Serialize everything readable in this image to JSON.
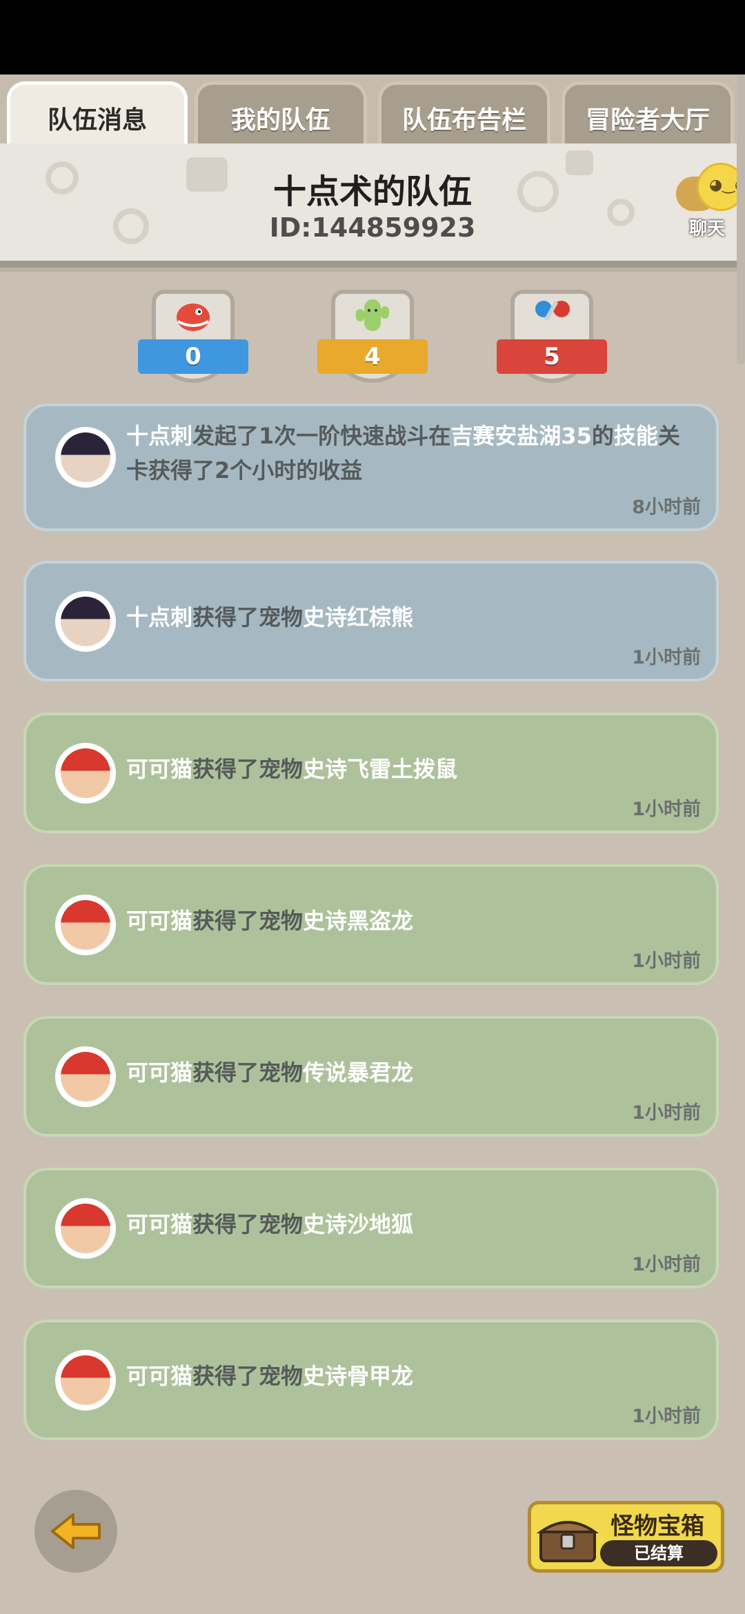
{
  "tabs": [
    {
      "label": "队伍消息",
      "active": true
    },
    {
      "label": "我的队伍",
      "active": false
    },
    {
      "label": "队伍布告栏",
      "active": false
    },
    {
      "label": "冒险者大厅",
      "active": false
    }
  ],
  "header": {
    "team_name": "十点术的队伍",
    "team_id": "ID:144859923",
    "chat_label": "聊天"
  },
  "badges": [
    {
      "value": "0",
      "color": "#3f97df",
      "icon": "red-dino-icon"
    },
    {
      "value": "4",
      "color": "#e8a92d",
      "icon": "green-cactus-icon"
    },
    {
      "value": "5",
      "color": "#d9453a",
      "icon": "adventurers-icon"
    }
  ],
  "messages": [
    {
      "style": "blue",
      "avatar": "dark-hair-hero-avatar",
      "parts": [
        {
          "t": "十点刺",
          "dark": false
        },
        {
          "t": "发起了1次一阶快速战斗在",
          "dark": true
        },
        {
          "t": "吉赛安盐湖35",
          "dark": false
        },
        {
          "t": "的",
          "dark": true
        },
        {
          "t": "技能",
          "dark": false
        },
        {
          "t": "关卡获得了2个小时的收益",
          "dark": true
        }
      ],
      "time": "8小时前"
    },
    {
      "style": "blue",
      "avatar": "dark-hair-hero-avatar",
      "parts": [
        {
          "t": "十点刺",
          "dark": false
        },
        {
          "t": "获得了宠物",
          "dark": true
        },
        {
          "t": "史诗红棕熊",
          "dark": false
        }
      ],
      "time": "1小时前"
    },
    {
      "style": "green",
      "avatar": "red-hair-hero-avatar",
      "parts": [
        {
          "t": "可可猫",
          "dark": false
        },
        {
          "t": "获得了宠物",
          "dark": true
        },
        {
          "t": "史诗飞雷土拨鼠",
          "dark": false
        }
      ],
      "time": "1小时前"
    },
    {
      "style": "green",
      "avatar": "red-hair-hero-avatar",
      "parts": [
        {
          "t": "可可猫",
          "dark": false
        },
        {
          "t": "获得了宠物",
          "dark": true
        },
        {
          "t": "史诗黑盗龙",
          "dark": false
        }
      ],
      "time": "1小时前"
    },
    {
      "style": "green",
      "avatar": "red-hair-hero-avatar",
      "parts": [
        {
          "t": "可可猫",
          "dark": false
        },
        {
          "t": "获得了宠物",
          "dark": true
        },
        {
          "t": "传说暴君龙",
          "dark": false
        }
      ],
      "time": "1小时前"
    },
    {
      "style": "green",
      "avatar": "red-hair-hero-avatar",
      "parts": [
        {
          "t": "可可猫",
          "dark": false
        },
        {
          "t": "获得了宠物",
          "dark": true
        },
        {
          "t": "史诗沙地狐",
          "dark": false
        }
      ],
      "time": "1小时前"
    },
    {
      "style": "green",
      "avatar": "red-hair-hero-avatar",
      "parts": [
        {
          "t": "可可猫",
          "dark": false
        },
        {
          "t": "获得了宠物",
          "dark": true
        },
        {
          "t": "史诗骨甲龙",
          "dark": false
        }
      ],
      "time": "1小时前"
    }
  ],
  "footer": {
    "back_icon": "arrow-left-icon",
    "chest_title": "怪物宝箱",
    "chest_status": "已结算"
  }
}
